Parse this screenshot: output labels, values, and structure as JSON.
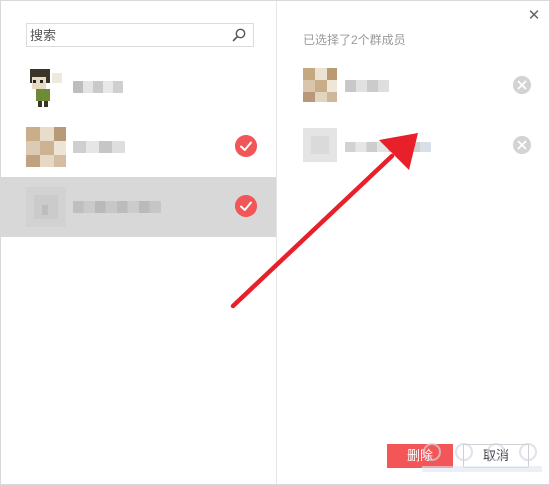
{
  "search": {
    "placeholder": "搜索"
  },
  "contacts": [
    {
      "selected": false
    },
    {
      "selected": true
    },
    {
      "selected": true,
      "highlighted": true
    }
  ],
  "selected_panel": {
    "count_text": "已选择了2个群成员",
    "members": [
      {
        "avatar": "photo"
      },
      {
        "avatar": "default"
      }
    ]
  },
  "buttons": {
    "delete_label": "删除",
    "cancel_label": "取消"
  },
  "colors": {
    "accent": "#f25656",
    "selected_row": "#d8d8d8",
    "annotation": "#e8202a"
  }
}
